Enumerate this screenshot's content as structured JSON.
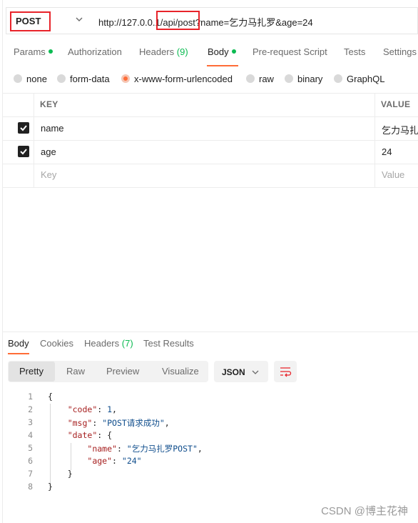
{
  "request": {
    "method": "POST",
    "url": "http://127.0.0.1/api/post?name=乞力马扎罗&age=24"
  },
  "request_tabs": [
    {
      "label": "Params",
      "dot": true
    },
    {
      "label": "Authorization"
    },
    {
      "label": "Headers",
      "count": "(9)"
    },
    {
      "label": "Body",
      "dot": true,
      "active": true
    },
    {
      "label": "Pre-request Script"
    },
    {
      "label": "Tests"
    },
    {
      "label": "Settings"
    }
  ],
  "body_types": [
    {
      "label": "none"
    },
    {
      "label": "form-data"
    },
    {
      "label": "x-www-form-urlencoded",
      "selected": true
    },
    {
      "label": "raw"
    },
    {
      "label": "binary"
    },
    {
      "label": "GraphQL"
    }
  ],
  "params_table": {
    "headers": {
      "key": "KEY",
      "value": "VALUE"
    },
    "rows": [
      {
        "key": "name",
        "value": "乞力马扎罗",
        "checked": true
      },
      {
        "key": "age",
        "value": "24",
        "checked": true
      }
    ],
    "placeholder": {
      "key": "Key",
      "value": "Value"
    }
  },
  "response_tabs": [
    {
      "label": "Body",
      "active": true
    },
    {
      "label": "Cookies"
    },
    {
      "label": "Headers",
      "count": "(7)"
    },
    {
      "label": "Test Results"
    }
  ],
  "view_modes": [
    "Pretty",
    "Raw",
    "Preview",
    "Visualize"
  ],
  "active_view_mode": "Pretty",
  "format": "JSON",
  "response_json": {
    "lines": [
      "1",
      "2",
      "3",
      "4",
      "5",
      "6",
      "7",
      "8"
    ],
    "code": 1,
    "msg": "POST请求成功",
    "date": {
      "name": "乞力马扎罗POST",
      "age": "24"
    }
  },
  "watermark": "CSDN @博主花神",
  "colors": {
    "accent": "#ff6c37",
    "highlight_box": "#e8232a",
    "status_green": "#0cbb52"
  },
  "icons": [
    "chevron-down-icon",
    "checkbox-checked-icon",
    "wrap-lines-icon"
  ]
}
